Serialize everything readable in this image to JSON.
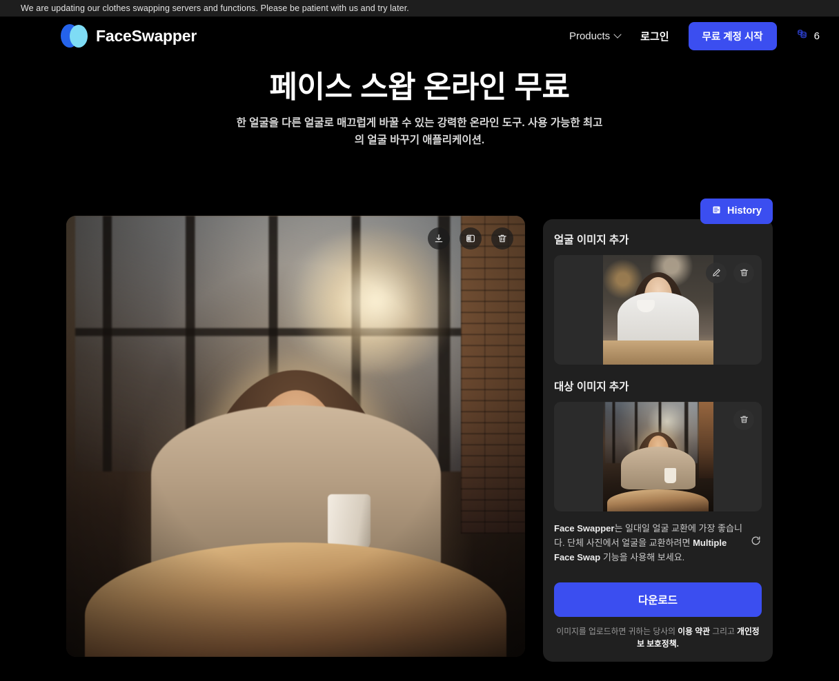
{
  "notice": {
    "text": "We are updating our clothes swapping servers and functions. Please be patient with us and try later."
  },
  "header": {
    "brand_name": "FaceSwapper",
    "logo_icon": "faceswapper-logo-icon",
    "nav": {
      "products_label": "Products",
      "chevron_icon": "chevron-down-icon",
      "login_label": "로그인",
      "cta_label": "무료 계정 시작",
      "credits_icon": "credits-coin-icon",
      "credits_count": "6"
    }
  },
  "hero": {
    "title": "페이스 스왑 온라인 무료",
    "subtitle": "한 얼굴을 다른 얼굴로 매끄럽게 바꿀 수 있는 강력한 온라인 도구. 사용 가능한 최고의 얼굴 바꾸기 애플리케이션."
  },
  "preview": {
    "toolbar": {
      "download_icon": "download-icon",
      "compare_icon": "compare-split-icon",
      "delete_icon": "trash-icon"
    },
    "image_alt": "웃고 있는 여성이 카페 창가 테이블에서 머그잔을 들고 앉아 있는 결과 이미지"
  },
  "side": {
    "history_label": "History",
    "history_icon": "history-book-icon",
    "face_section": {
      "label": "얼굴 이미지 추가",
      "edit_icon": "pencil-edit-icon",
      "delete_icon": "trash-icon",
      "image_alt": "커피잔을 든 여성 얼굴 소스 이미지"
    },
    "target_section": {
      "label": "대상 이미지 추가",
      "delete_icon": "trash-icon",
      "image_alt": "카페 창가에 앉은 여성 대상 이미지"
    },
    "hint": {
      "text_part1": "Face Swapper",
      "text_part2": "는 일대일 얼굴 교환에 가장 좋습니다. 단체 사진에서 얼굴을 교환하려면 ",
      "text_part3": "Multiple Face Swap",
      "text_part4": " 기능을 사용해 보세요.",
      "link_icon": "external-refresh-icon"
    },
    "download_label": "다운로드",
    "terms": {
      "prefix": "이미지를 업로드하면 귀하는 당사의 ",
      "terms_link": "이용 약관",
      "middle": " 그리고 ",
      "privacy_link": "개인정보 보호정책."
    }
  },
  "colors": {
    "accent": "#3b4ef0",
    "page_bg": "#000000",
    "panel_bg": "#202020",
    "notice_bg": "#1e1e1e",
    "logo_blue": "#2563eb",
    "logo_cyan": "#7edcf5"
  }
}
